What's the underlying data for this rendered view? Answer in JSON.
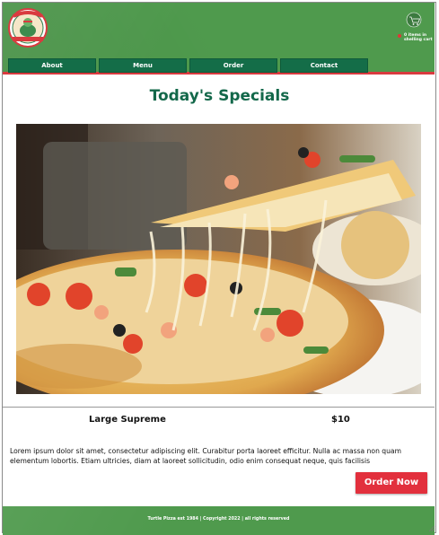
{
  "brand": {
    "logo_text_top": "TURTLE PIZZA",
    "logo_text_bottom": "EST. 1984"
  },
  "cart": {
    "icon": "cart-icon",
    "label": "0 items in shelling cart"
  },
  "nav": {
    "items": [
      {
        "label": "About"
      },
      {
        "label": "Menu"
      },
      {
        "label": "Order"
      },
      {
        "label": "Contact"
      }
    ]
  },
  "main": {
    "title": "Today's Specials",
    "item_name": "Large Supreme",
    "item_price": "$10",
    "description": "Lorem ipsum dolor sit amet, consectetur adipiscing elit. Curabitur porta laoreet efficitur. Nulla ac massa non quam elementum lobortis. Etiam ultricies, diam at laoreet sollicitudin, odio enim consequat neque, quis facilisis",
    "order_button": "Order Now"
  },
  "footer": {
    "text": "Turtle Pizza est 1984 | Copyright 2022 | all rights reserved"
  },
  "colors": {
    "header_green": "#4f9a4d",
    "nav_green": "#146d48",
    "accent_red": "#e2303d",
    "title_green": "#13684a"
  }
}
